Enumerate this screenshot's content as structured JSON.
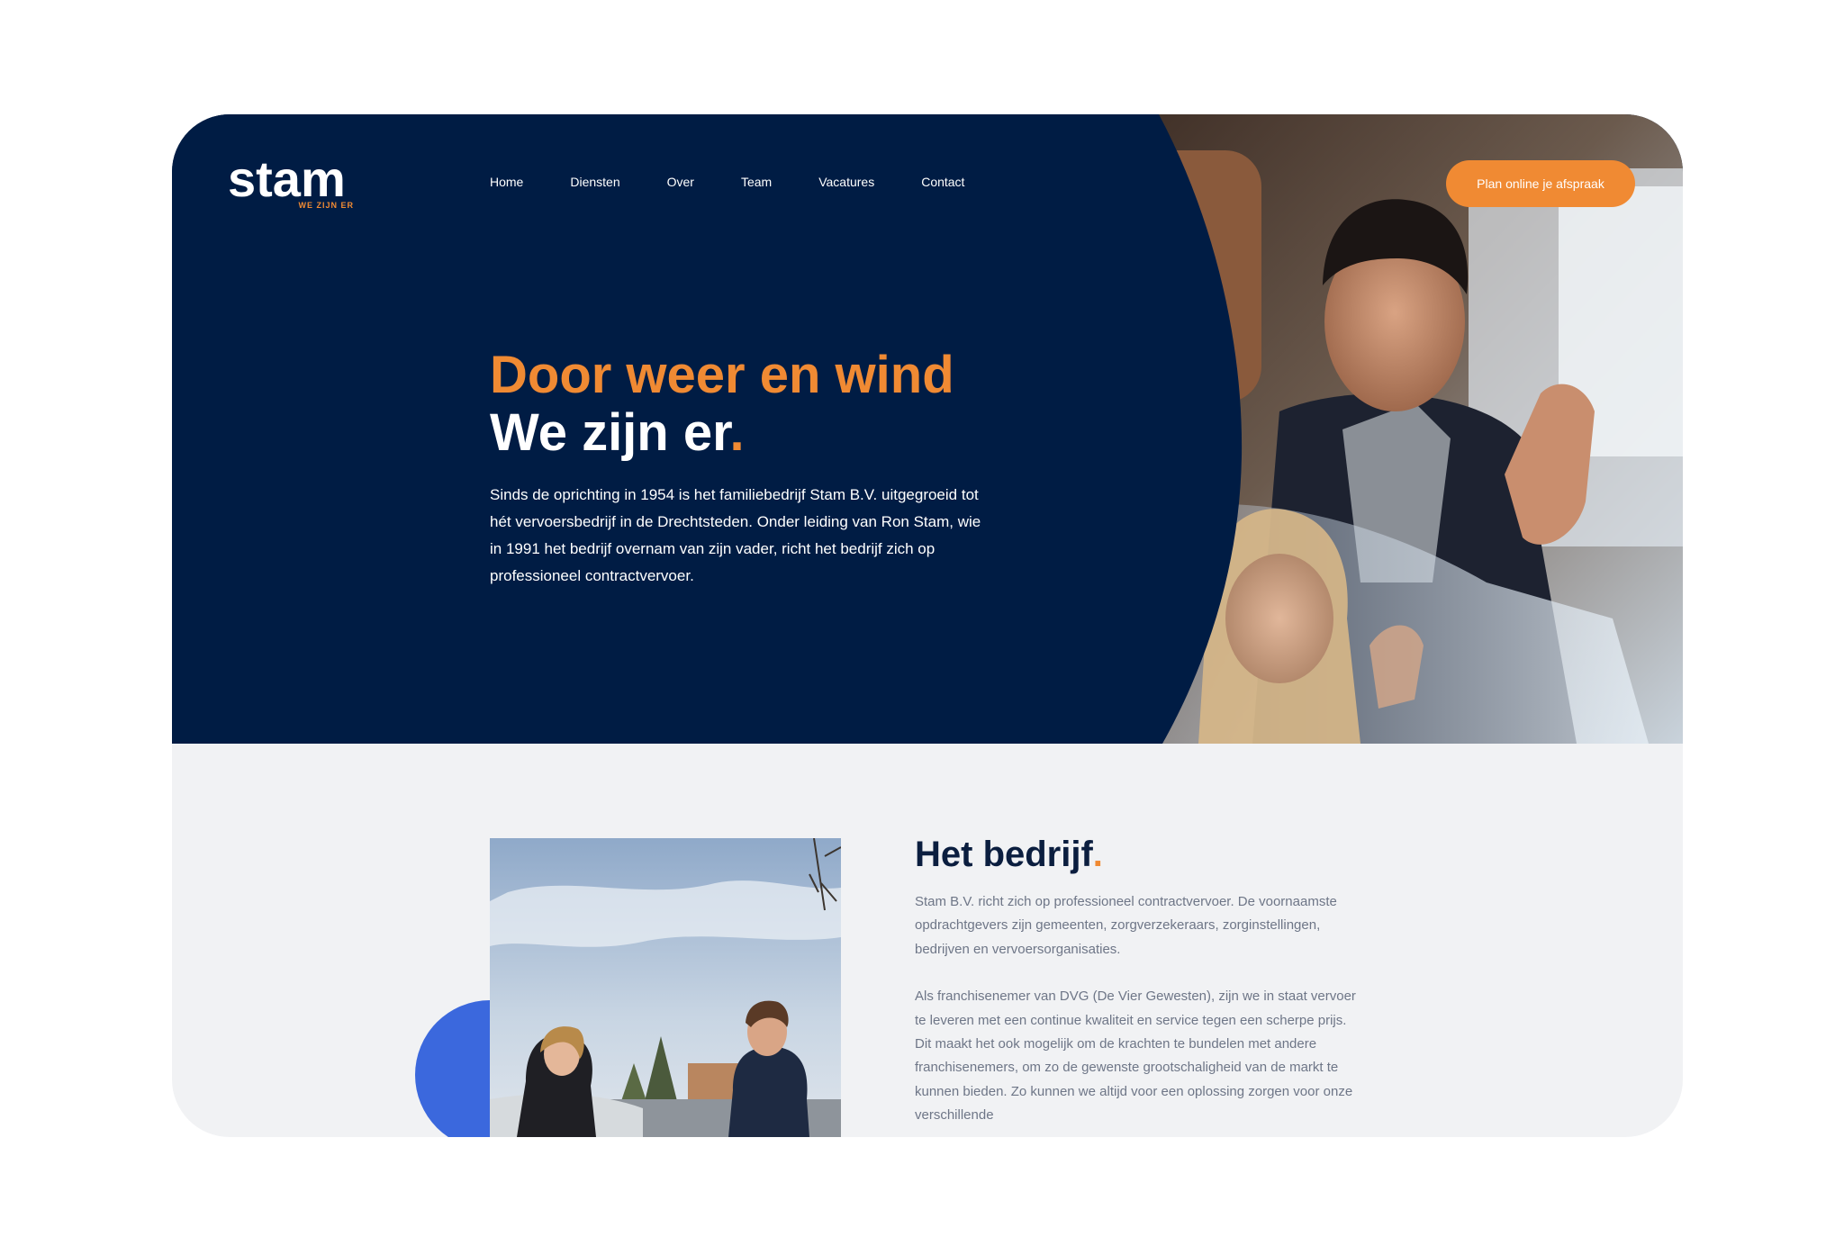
{
  "logo": {
    "word": "stam",
    "tagline": "WE ZIJN ER"
  },
  "nav": [
    "Home",
    "Diensten",
    "Over",
    "Team",
    "Vacatures",
    "Contact"
  ],
  "cta_label": "Plan online je afspraak",
  "hero": {
    "headline_line1": "Door weer en wind",
    "headline_line2": "We zijn er",
    "headline_dot": ".",
    "body": "Sinds de oprichting in 1954 is het familiebedrijf Stam B.V. uitgegroeid tot hét vervoersbedrijf in de Drechtsteden. Onder leiding van Ron Stam, wie in 1991 het bedrijf overnam van zijn vader, richt het bedrijf zich op professioneel contractvervoer."
  },
  "about": {
    "title": "Het bedrijf",
    "title_dot": ".",
    "paragraph1": "Stam B.V. richt zich op professioneel contractvervoer. De voornaamste opdrachtgevers zijn gemeenten, zorgverzekeraars, zorginstellingen, bedrijven en vervoersorganisaties.",
    "paragraph2": "Als franchisenemer van DVG (De Vier Gewesten), zijn we in staat vervoer te leveren met een continue kwaliteit en service tegen een scherpe prijs. Dit maakt het ook mogelijk om de krachten te bundelen met andere franchisenemers, om zo de gewenste grootschaligheid van de markt te kunnen bieden. Zo kunnen we altijd voor een oplossing zorgen voor onze verschillende"
  },
  "colors": {
    "navy": "#001c44",
    "orange": "#f08a33",
    "blue": "#3b68dd",
    "light_bg": "#f1f2f4"
  }
}
